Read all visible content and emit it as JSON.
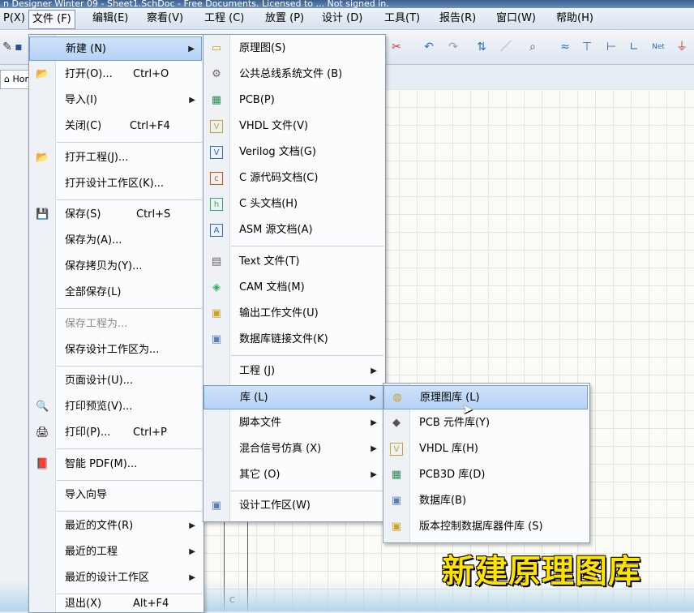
{
  "window_title": "n Designer Winter 09 - Sheet1.SchDoc - Free Documents. Licensed to ... Not signed in.",
  "menubar": {
    "items": [
      {
        "label": "P(X)"
      },
      {
        "label": "文件 (F)"
      },
      {
        "label": "编辑(E)"
      },
      {
        "label": "察看(V)"
      },
      {
        "label": "工程 (C)"
      },
      {
        "label": "放置 (P)"
      },
      {
        "label": "设计 (D)"
      },
      {
        "label": "工具(T)"
      },
      {
        "label": "报告(R)"
      },
      {
        "label": "窗口(W)"
      },
      {
        "label": "帮助(H)"
      }
    ]
  },
  "tabs": {
    "home": "Home"
  },
  "file_menu": {
    "items": [
      {
        "label": "新建 (N)",
        "shortcut": "",
        "arrow": "▶",
        "icon": ""
      },
      {
        "label": "打开(O)...",
        "shortcut": "Ctrl+O",
        "arrow": "",
        "icon": "📂"
      },
      {
        "label": "导入(I)",
        "shortcut": "",
        "arrow": "▶",
        "icon": ""
      },
      {
        "label": "关闭(C)",
        "shortcut": "Ctrl+F4",
        "arrow": "",
        "icon": ""
      },
      {
        "label": "打开工程(J)...",
        "shortcut": "",
        "arrow": "",
        "icon": "📂"
      },
      {
        "label": "打开设计工作区(K)...",
        "shortcut": "",
        "arrow": "",
        "icon": ""
      },
      {
        "label": "保存(S)",
        "shortcut": "Ctrl+S",
        "arrow": "",
        "icon": "💾"
      },
      {
        "label": "保存为(A)...",
        "shortcut": "",
        "arrow": "",
        "icon": ""
      },
      {
        "label": "保存拷贝为(Y)...",
        "shortcut": "",
        "arrow": "",
        "icon": ""
      },
      {
        "label": "全部保存(L)",
        "shortcut": "",
        "arrow": "",
        "icon": ""
      },
      {
        "label": "保存工程为...",
        "shortcut": "",
        "arrow": "",
        "icon": ""
      },
      {
        "label": "保存设计工作区为...",
        "shortcut": "",
        "arrow": "",
        "icon": ""
      },
      {
        "label": "页面设计(U)...",
        "shortcut": "",
        "arrow": "",
        "icon": ""
      },
      {
        "label": "打印预览(V)...",
        "shortcut": "",
        "arrow": "",
        "icon": "🔍"
      },
      {
        "label": "打印(P)...",
        "shortcut": "Ctrl+P",
        "arrow": "",
        "icon": "🖨"
      },
      {
        "label": "智能 PDF(M)...",
        "shortcut": "",
        "arrow": "",
        "icon": "📕"
      },
      {
        "label": "导入向导",
        "shortcut": "",
        "arrow": "",
        "icon": ""
      },
      {
        "label": "最近的文件(R)",
        "shortcut": "",
        "arrow": "▶",
        "icon": ""
      },
      {
        "label": "最近的工程",
        "shortcut": "",
        "arrow": "▶",
        "icon": ""
      },
      {
        "label": "最近的设计工作区",
        "shortcut": "",
        "arrow": "▶",
        "icon": ""
      },
      {
        "label": "退出(X)",
        "shortcut": "Alt+F4",
        "arrow": "",
        "icon": ""
      }
    ]
  },
  "new_menu": {
    "items": [
      {
        "label": "原理图(S)",
        "arrow": "",
        "icon": "▭"
      },
      {
        "label": "公共总线系统文件 (B)",
        "arrow": "",
        "icon": "⚙"
      },
      {
        "label": "PCB(P)",
        "arrow": "",
        "icon": "▦"
      },
      {
        "label": "VHDL 文件(V)",
        "arrow": "",
        "icon": "V"
      },
      {
        "label": "Verilog 文档(G)",
        "arrow": "",
        "icon": "V"
      },
      {
        "label": "C 源代码文档(C)",
        "arrow": "",
        "icon": "c"
      },
      {
        "label": "C 头文档(H)",
        "arrow": "",
        "icon": "h"
      },
      {
        "label": "ASM 源文档(A)",
        "arrow": "",
        "icon": "A"
      },
      {
        "label": "Text  文件(T)",
        "arrow": "",
        "icon": "▤"
      },
      {
        "label": "CAM 文档(M)",
        "arrow": "",
        "icon": "◈"
      },
      {
        "label": "输出工作文件(U)",
        "arrow": "",
        "icon": "▣"
      },
      {
        "label": "数据库链接文件(K)",
        "arrow": "",
        "icon": "▣"
      },
      {
        "label": "工程 (J)",
        "arrow": "▶",
        "icon": ""
      },
      {
        "label": "库 (L)",
        "arrow": "▶",
        "icon": ""
      },
      {
        "label": "脚本文件",
        "arrow": "▶",
        "icon": ""
      },
      {
        "label": "混合信号仿真 (X)",
        "arrow": "▶",
        "icon": ""
      },
      {
        "label": "其它 (O)",
        "arrow": "▶",
        "icon": ""
      },
      {
        "label": "设计工作区(W)",
        "arrow": "",
        "icon": "▣"
      }
    ]
  },
  "lib_menu": {
    "items": [
      {
        "label": "原理图库 (L)",
        "icon": "◍"
      },
      {
        "label": "PCB 元件库(Y)",
        "icon": "◆"
      },
      {
        "label": "VHDL 库(H)",
        "icon": "V"
      },
      {
        "label": "PCB3D 库(D)",
        "icon": "▦"
      },
      {
        "label": "数据库(B)",
        "icon": "▣"
      },
      {
        "label": "版本控制数据库器件库 (S)",
        "icon": "▣"
      }
    ]
  },
  "caption": "新建原理图库",
  "panel_letter": "C"
}
